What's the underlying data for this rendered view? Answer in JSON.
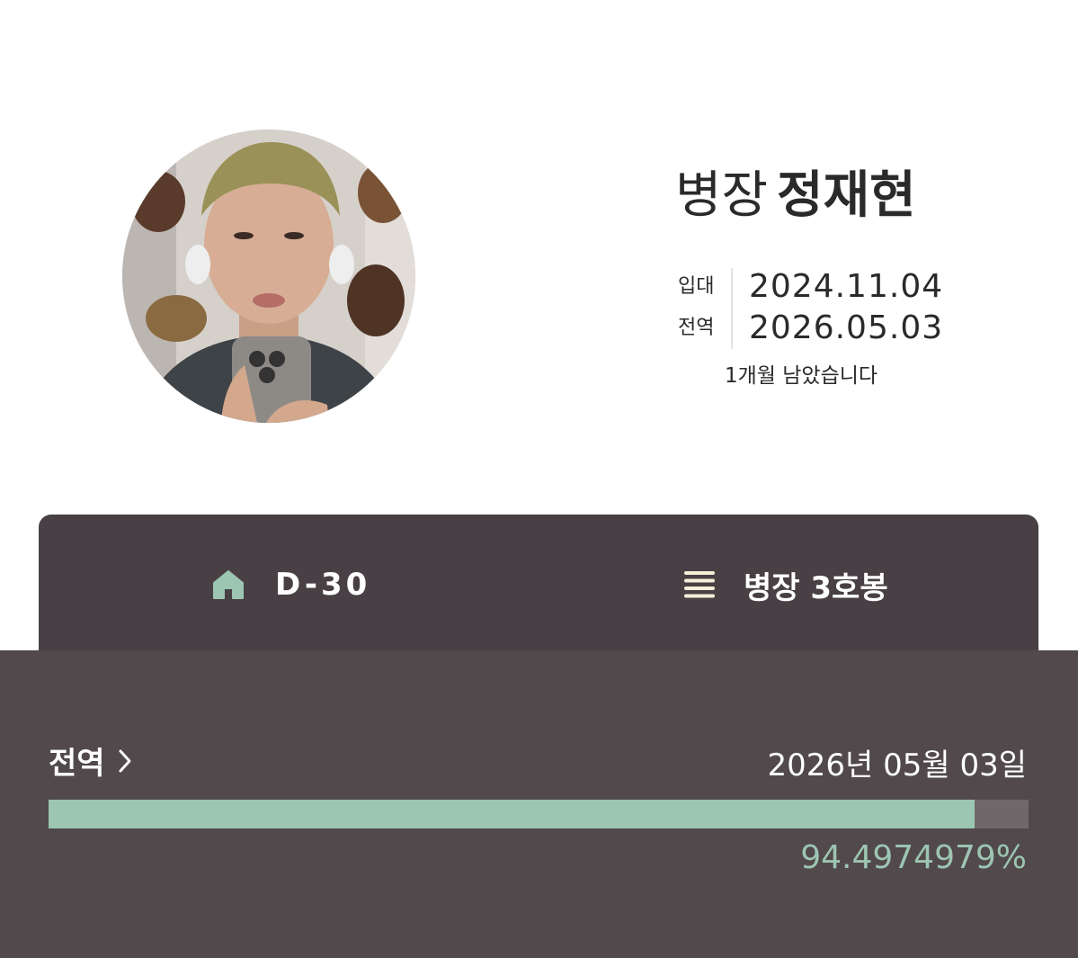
{
  "profile": {
    "rank": "병장",
    "name": "정재현",
    "enlist_label": "입대",
    "enlist_date": "2024.11.04",
    "discharge_label": "전역",
    "discharge_date": "2026.05.03",
    "remaining_text": "1개월 남았습니다",
    "avatar_icon": "profile-photo"
  },
  "tabs": [
    {
      "icon": "home-icon",
      "label": "D-30"
    },
    {
      "icon": "list-icon",
      "label": "병장 3호봉"
    }
  ],
  "progress_section": {
    "title": "전역",
    "title_icon": "chevron-right-icon",
    "date": "2026년 05월 03일",
    "percent_text": "94.4974979%",
    "percent_value": 94.4974979
  },
  "colors": {
    "accent": "#9cc5b2",
    "tab_bar_bg": "#484044",
    "panel_bg": "#51494c",
    "track_bg": "#6f676a",
    "list_icon": "#f4efd8"
  }
}
